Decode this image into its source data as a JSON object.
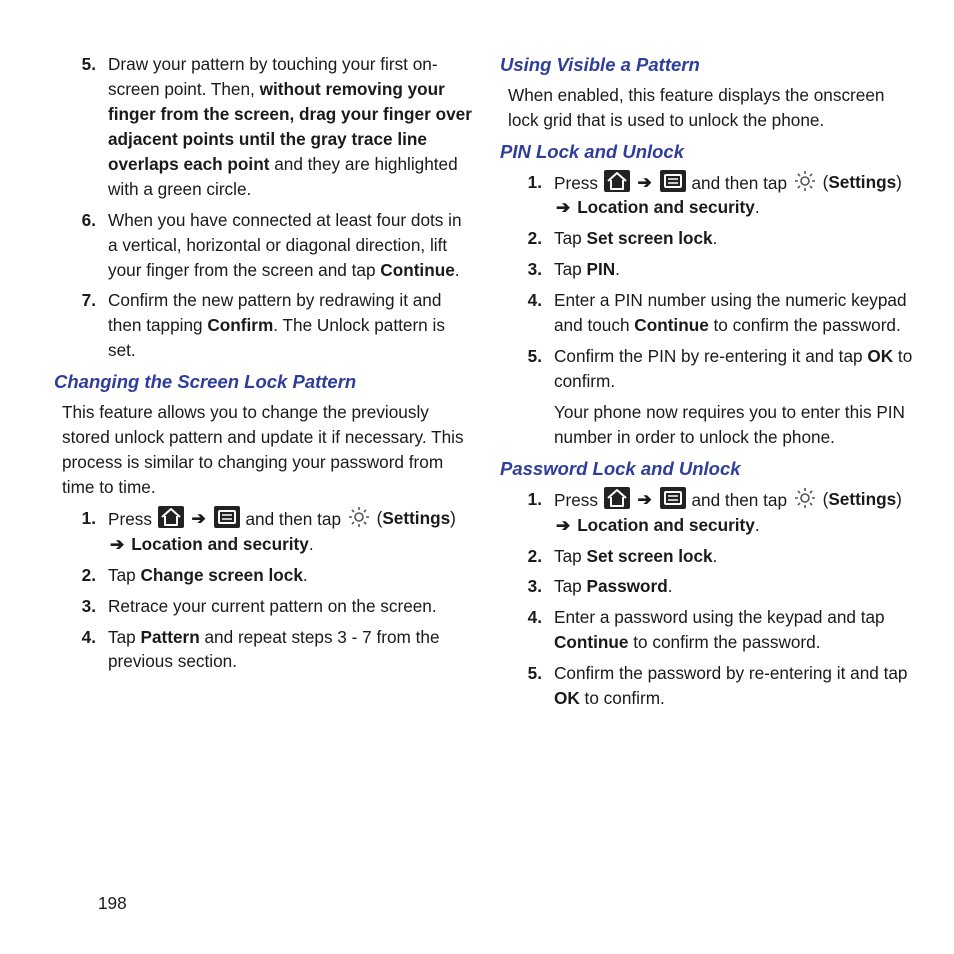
{
  "leftColumn": {
    "steps": [
      {
        "num": "5.",
        "pieces": [
          {
            "t": "Draw your pattern by touching your first on-screen point. Then, "
          },
          {
            "t": "without removing your finger from the screen, drag your finger over adjacent points until the gray trace line overlaps each point",
            "b": true
          },
          {
            "t": " and they are highlighted with a green circle."
          }
        ]
      },
      {
        "num": "6.",
        "pieces": [
          {
            "t": "When you have connected at least four dots in a vertical, horizontal or diagonal direction, lift your finger from the screen and tap "
          },
          {
            "t": "Continue",
            "b": true
          },
          {
            "t": "."
          }
        ]
      },
      {
        "num": "7.",
        "pieces": [
          {
            "t": "Confirm the new pattern by redrawing it and then tapping "
          },
          {
            "t": "Confirm",
            "b": true
          },
          {
            "t": ". The Unlock pattern is set."
          }
        ]
      }
    ],
    "heading1": "Changing the Screen Lock Pattern",
    "intro1": "This feature allows you to change the previously stored unlock pattern and update it if necessary. This process is similar to changing your password from time to time.",
    "steps2": [
      {
        "num": "1.",
        "press": true,
        "tail": [
          {
            "t": "("
          },
          {
            "t": "Settings",
            "b": true
          },
          {
            "t": ") "
          },
          {
            "arrow": true
          },
          {
            "t": " "
          },
          {
            "t": "Location and security",
            "b": true
          },
          {
            "t": "."
          }
        ]
      },
      {
        "num": "2.",
        "pieces": [
          {
            "t": "Tap "
          },
          {
            "t": "Change screen lock",
            "b": true
          },
          {
            "t": "."
          }
        ]
      },
      {
        "num": "3.",
        "pieces": [
          {
            "t": "Retrace your current pattern on the screen."
          }
        ]
      },
      {
        "num": "4.",
        "pieces": [
          {
            "t": "Tap "
          },
          {
            "t": "Pattern",
            "b": true
          },
          {
            "t": " and repeat steps 3 - 7 from the previous section."
          }
        ]
      }
    ]
  },
  "rightColumn": {
    "heading1": "Using Visible a Pattern",
    "intro1": "When enabled, this feature displays the onscreen lock grid that is used to unlock the phone.",
    "heading2": "PIN Lock and Unlock",
    "steps2": [
      {
        "num": "1.",
        "press": true,
        "tail": [
          {
            "t": "("
          },
          {
            "t": "Settings",
            "b": true
          },
          {
            "t": ") "
          },
          {
            "arrow": true
          },
          {
            "t": " "
          },
          {
            "t": "Location and security",
            "b": true
          },
          {
            "t": "."
          }
        ]
      },
      {
        "num": "2.",
        "pieces": [
          {
            "t": "Tap "
          },
          {
            "t": "Set screen lock",
            "b": true
          },
          {
            "t": "."
          }
        ]
      },
      {
        "num": "3.",
        "pieces": [
          {
            "t": "Tap "
          },
          {
            "t": "PIN",
            "b": true
          },
          {
            "t": "."
          }
        ]
      },
      {
        "num": "4.",
        "pieces": [
          {
            "t": "Enter a PIN number using the numeric keypad and touch "
          },
          {
            "t": "Continue",
            "b": true
          },
          {
            "t": " to confirm the password."
          }
        ]
      },
      {
        "num": "5.",
        "pieces": [
          {
            "t": "Confirm the PIN by re-entering it and tap "
          },
          {
            "t": "OK",
            "b": true
          },
          {
            "t": " to confirm."
          }
        ],
        "note": "Your phone now requires you to enter this PIN number in order to unlock the phone."
      }
    ],
    "heading3": "Password Lock and Unlock",
    "steps3": [
      {
        "num": "1.",
        "press": true,
        "tail": [
          {
            "t": "("
          },
          {
            "t": "Settings",
            "b": true
          },
          {
            "t": ") "
          },
          {
            "arrow": true
          },
          {
            "t": " "
          },
          {
            "t": "Location and security",
            "b": true
          },
          {
            "t": "."
          }
        ]
      },
      {
        "num": "2.",
        "pieces": [
          {
            "t": "Tap "
          },
          {
            "t": "Set screen lock",
            "b": true
          },
          {
            "t": "."
          }
        ]
      },
      {
        "num": "3.",
        "pieces": [
          {
            "t": "Tap "
          },
          {
            "t": "Password",
            "b": true
          },
          {
            "t": "."
          }
        ]
      },
      {
        "num": "4.",
        "pieces": [
          {
            "t": "Enter a password using the keypad and tap "
          },
          {
            "t": "Continue",
            "b": true
          },
          {
            "t": " to confirm the password."
          }
        ]
      },
      {
        "num": "5.",
        "pieces": [
          {
            "t": "Confirm the password by re-entering it and tap "
          },
          {
            "t": "OK",
            "b": true
          },
          {
            "t": " to confirm."
          }
        ]
      }
    ]
  },
  "labels": {
    "press": "Press ",
    "andThenTap": " and then tap ",
    "arrow": "➔"
  },
  "pageNumber": "198"
}
